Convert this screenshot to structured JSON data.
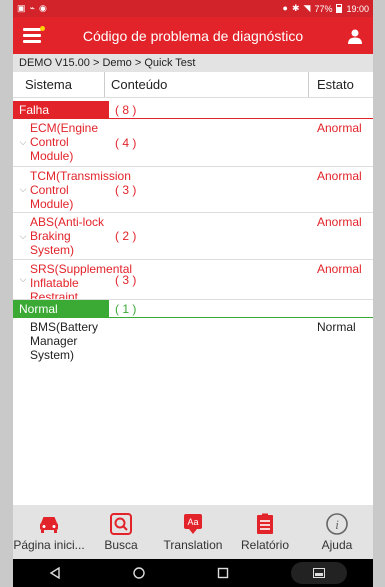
{
  "status_bar": {
    "time": "19:00",
    "battery": "77%"
  },
  "header": {
    "title": "Código de problema de diagnóstico"
  },
  "breadcrumb": "DEMO V15.00 > Demo > Quick Test",
  "table_headers": {
    "system": "Sistema",
    "content": "Conteúdo",
    "state": "Estato"
  },
  "groups": {
    "falha": {
      "label": "Falha",
      "count": "( 8 )",
      "color": "#e2232a"
    },
    "normal": {
      "label": "Normal",
      "count": "( 1 )",
      "color": "#3aaa35"
    }
  },
  "fault_rows": [
    {
      "system": "ECM(Engine Control Module)",
      "count": "( 4 )",
      "status": "Anormal"
    },
    {
      "system": "TCM(Transmission Control Module)",
      "count": "( 3 )",
      "status": "Anormal"
    },
    {
      "system": "ABS(Anti-lock Braking System)",
      "count": "( 2 )",
      "status": "Anormal"
    },
    {
      "system": "SRS(Supplemental Inflatable Restraint",
      "count": "( 3 )",
      "status": "Anormal"
    }
  ],
  "normal_rows": [
    {
      "system": "BMS(Battery Manager System)",
      "status": "Normal"
    }
  ],
  "bottom_nav": [
    {
      "label": "Página inici...",
      "icon": "car-icon"
    },
    {
      "label": "Busca",
      "icon": "search-icon"
    },
    {
      "label": "Translation",
      "icon": "translation-icon"
    },
    {
      "label": "Relatório",
      "icon": "report-icon"
    },
    {
      "label": "Ajuda",
      "icon": "help-icon"
    }
  ],
  "colors": {
    "accent": "#e2232a",
    "normal": "#3aaa35"
  }
}
